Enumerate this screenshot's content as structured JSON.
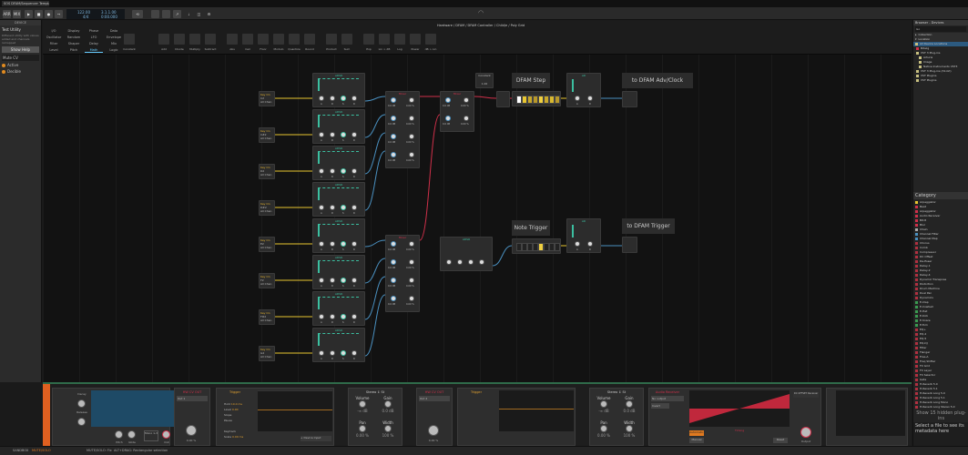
{
  "window": {
    "tab_title": "SOS DFAM/Sequencer Template.bwproject"
  },
  "transport": {
    "tempo": "122.00",
    "signature": "4/4",
    "position": "3.1.1.00",
    "time": "0:00.000",
    "play_label": "PLAY",
    "rec_label": "REC",
    "arr_label": "ARR",
    "mix_label": "MIX"
  },
  "left_panel": {
    "header": "DEVICE",
    "title": "Test Utility",
    "description": "Different utility with values added and channels remapped",
    "help_button": "Show Help",
    "field": "Mute CV",
    "options": [
      "Active",
      "Decible"
    ]
  },
  "palette": {
    "categories": [
      "I/O",
      "Display",
      "Phase",
      "Data",
      "Oscillator",
      "Random",
      "LFO",
      "Envelope",
      "Filter",
      "Shaper",
      "Delay",
      "Mix",
      "Level",
      "Pitch",
      "Math",
      "Logic"
    ],
    "modules": [
      "Constant",
      "Add",
      "Divide",
      "Multiply",
      "Subtract",
      "Abs",
      "Ceil",
      "Floor",
      "Modulo",
      "Quantize",
      "Round",
      "Product",
      "Sum",
      "Exp",
      "Lin > dB",
      "Log",
      "Power",
      "dB > Lin"
    ]
  },
  "breadcrumb": "Hardware / DFAM / DFAM Controller / Child/e / Poly Grid",
  "canvas": {
    "key_on": {
      "title": "Key On",
      "notes": [
        "C2",
        "C#2",
        "D2",
        "D#2",
        "E2",
        "F2",
        "F#2",
        "G2"
      ],
      "channel": "All Chan"
    },
    "adsr_title": "ADSR",
    "adsr_knobs": [
      "A",
      "D",
      "S",
      "R"
    ],
    "mixer_title": "Mixer",
    "mixer_gain": "0.0 dB",
    "mixer_offset": "0.00 %",
    "constant": {
      "title": "Constant",
      "value": "1.00"
    },
    "step_label": "DFAM Step",
    "step_out_label": "to DFAM Adv/Clock",
    "trigger_label": "Note Trigger",
    "trigger_out_label": "to DFAM Trigger",
    "ad_title": "AD",
    "ad_knobs": [
      "A",
      "D"
    ]
  },
  "devices": {
    "d1": {
      "title": "Poly Grid",
      "knobs": [
        "Decay",
        "Release",
        "Pitch",
        "Glide",
        "Out"
      ],
      "voice": "Mono 1-3"
    },
    "cv1": {
      "title": "HW CV OUT",
      "out": "Out 1",
      "value": "0.00 %"
    },
    "trig1": {
      "title": "Trigger",
      "hold": "Hold",
      "hold_val": "10.0 ms",
      "level": "Level",
      "level_val": "0.00",
      "slope": "Slope",
      "pause": "Pause",
      "keytrack": "Keytrack",
      "scale": "Scale",
      "scale_val": "0.00 ms",
      "input": "+ Device Input"
    },
    "tool1": {
      "title": "Stereo ↕ St",
      "knobs": [
        "Volume",
        "Gain",
        "Pan",
        "Width"
      ],
      "vals": [
        "-∞ dB",
        "0.0 dB",
        "0.00 %",
        "100 %"
      ]
    },
    "cv2": {
      "title": "HW CV OUT",
      "out": "Out 2",
      "value": "0.00 %"
    },
    "receiver": {
      "title": "Audio Receiver",
      "source": "No output",
      "invert": "Invert",
      "auto": "Automatic",
      "manual": "Manual",
      "reset": "Reset",
      "timing": "Timing",
      "output": "Output",
      "offset": "DC OFFSET Receiver"
    }
  },
  "browser": {
    "header": "Browser - Devices",
    "search": "Go",
    "collection": "Collection",
    "location": "Location",
    "locations": [
      "All Device Locations",
      "Bitwig",
      "VST 3 Plug-ins",
      "Arturia",
      "Image",
      "Native Instruments VST3",
      "VST 3 Plug-ins (32-bit)",
      "VST Plugins",
      "VST Plugins"
    ],
    "category_header": "Category",
    "categories": [
      "Arpeggiator",
      "Beat",
      "Arpeggiator",
      "Audio Receiver",
      "Bit-8",
      "Blur",
      "Chain",
      "Channel Filter",
      "Channel Map",
      "Chorus",
      "Comb",
      "Compressor",
      "DC Offset",
      "De-Esser",
      "Delay-1",
      "Delay-2",
      "Delay-4",
      "Dynamic Transpose",
      "Distortion",
      "Drum Machine",
      "Dual Pan",
      "Dynamics",
      "E-Clap",
      "E-Cowbell",
      "E-Hat",
      "E-Kick",
      "E-Snare",
      "E-Tom",
      "EQ+",
      "EQ-2",
      "EQ-5",
      "EQ-DJ",
      "Filter",
      "Flanger",
      "Free-A",
      "Freq Shifter",
      "FX Grid",
      "FX Layer",
      "FX Selector",
      "Gate",
      "H-Reverb 5.0",
      "H-Reverb 5.1",
      "H-Reverb Long 5.0",
      "H-Reverb Long 5.1",
      "H-Reverb Long Mono",
      "H-Reverb Long Stereo 5.0"
    ],
    "hidden": "Show 15 hidden plug-ins",
    "meta": "Select a file to see its metadata here"
  },
  "status": {
    "mode": "SANDBOX",
    "mute": "MUTE/SOLO",
    "hint1": "MUTE/SOLO: Fix",
    "hint2": "ALT+DRAG: Rectangular selection"
  },
  "colors": {
    "accent": "#e08a20",
    "teal": "#3bbfa0",
    "red": "#d0304a",
    "yellow": "#e8c630",
    "blue": "#4a90c0"
  }
}
